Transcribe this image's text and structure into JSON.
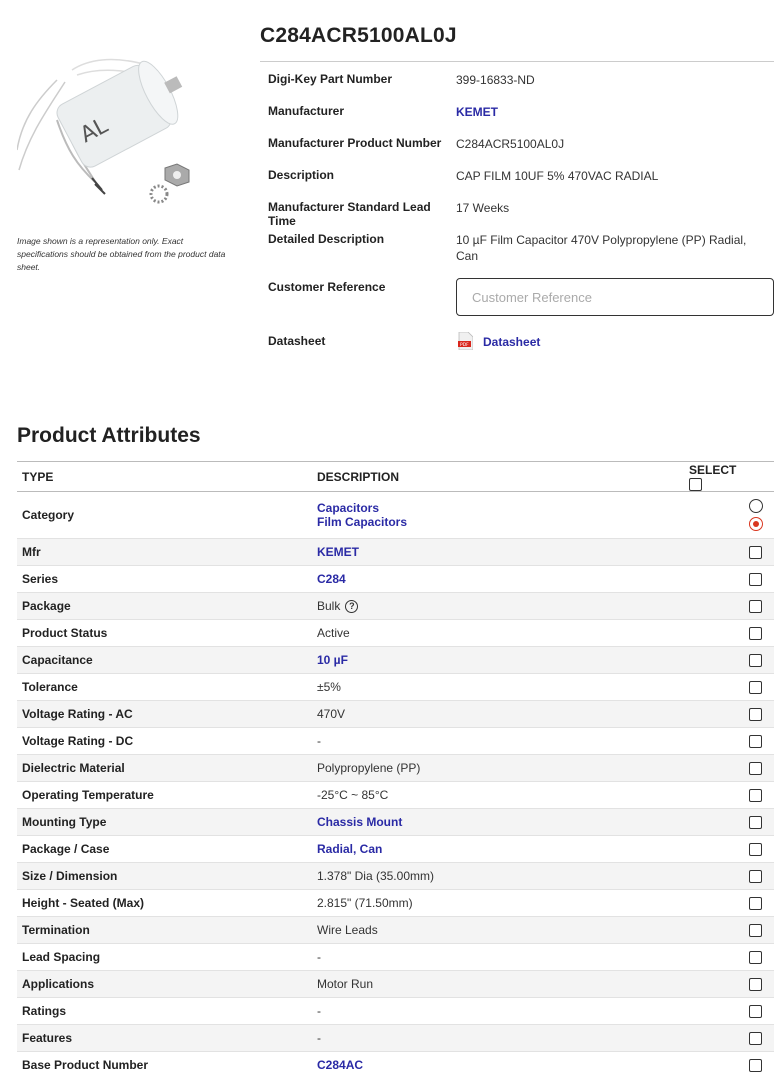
{
  "product": {
    "title": "C284ACR5100AL0J",
    "image_note": "Image shown is a representation only. Exact specifications should be obtained from the product data sheet."
  },
  "info": {
    "digikey_label": "Digi-Key Part Number",
    "digikey_value": "399-16833-ND",
    "manufacturer_label": "Manufacturer",
    "manufacturer_value": "KEMET",
    "mpn_label": "Manufacturer Product Number",
    "mpn_value": "C284ACR5100AL0J",
    "description_label": "Description",
    "description_value": "CAP FILM 10UF 5% 470VAC RADIAL",
    "leadtime_label": "Manufacturer Standard Lead Time",
    "leadtime_value": "17 Weeks",
    "detailed_label": "Detailed Description",
    "detailed_value": "10 µF Film Capacitor 470V Polypropylene (PP) Radial, Can",
    "custref_label": "Customer Reference",
    "custref_placeholder": "Customer Reference",
    "datasheet_label": "Datasheet",
    "datasheet_link": "Datasheet"
  },
  "attributes": {
    "section_title": "Product Attributes",
    "headers": {
      "type": "TYPE",
      "description": "DESCRIPTION",
      "select": "SELECT"
    },
    "category": {
      "type": "Category",
      "values": [
        "Capacitors",
        "Film Capacitors"
      ]
    },
    "rows": [
      {
        "type": "Mfr",
        "value": "KEMET",
        "link": true
      },
      {
        "type": "Series",
        "value": "C284",
        "link": true
      },
      {
        "type": "Package",
        "value": "Bulk",
        "link": false,
        "help": true
      },
      {
        "type": "Product Status",
        "value": "Active",
        "link": false
      },
      {
        "type": "Capacitance",
        "value": "10 µF",
        "link": true
      },
      {
        "type": "Tolerance",
        "value": "±5%",
        "link": false
      },
      {
        "type": "Voltage Rating - AC",
        "value": "470V",
        "link": false
      },
      {
        "type": "Voltage Rating - DC",
        "value": "-",
        "link": false
      },
      {
        "type": "Dielectric Material",
        "value": "Polypropylene (PP)",
        "link": false
      },
      {
        "type": "Operating Temperature",
        "value": "-25°C ~ 85°C",
        "link": false
      },
      {
        "type": "Mounting Type",
        "value": "Chassis Mount",
        "link": true
      },
      {
        "type": "Package / Case",
        "value": "Radial, Can",
        "link": true
      },
      {
        "type": "Size / Dimension",
        "value": "1.378\" Dia (35.00mm)",
        "link": false
      },
      {
        "type": "Height - Seated (Max)",
        "value": "2.815\" (71.50mm)",
        "link": false
      },
      {
        "type": "Termination",
        "value": "Wire Leads",
        "link": false
      },
      {
        "type": "Lead Spacing",
        "value": "-",
        "link": false
      },
      {
        "type": "Applications",
        "value": "Motor Run",
        "link": false
      },
      {
        "type": "Ratings",
        "value": "-",
        "link": false
      },
      {
        "type": "Features",
        "value": "-",
        "link": false
      },
      {
        "type": "Base Product Number",
        "value": "C284AC",
        "link": true
      }
    ]
  },
  "colors": {
    "link": "#2a2aa5",
    "radio_selected": "#d9361f"
  },
  "icons": {
    "pdf": "pdf-icon",
    "help": "help-circle-icon"
  }
}
